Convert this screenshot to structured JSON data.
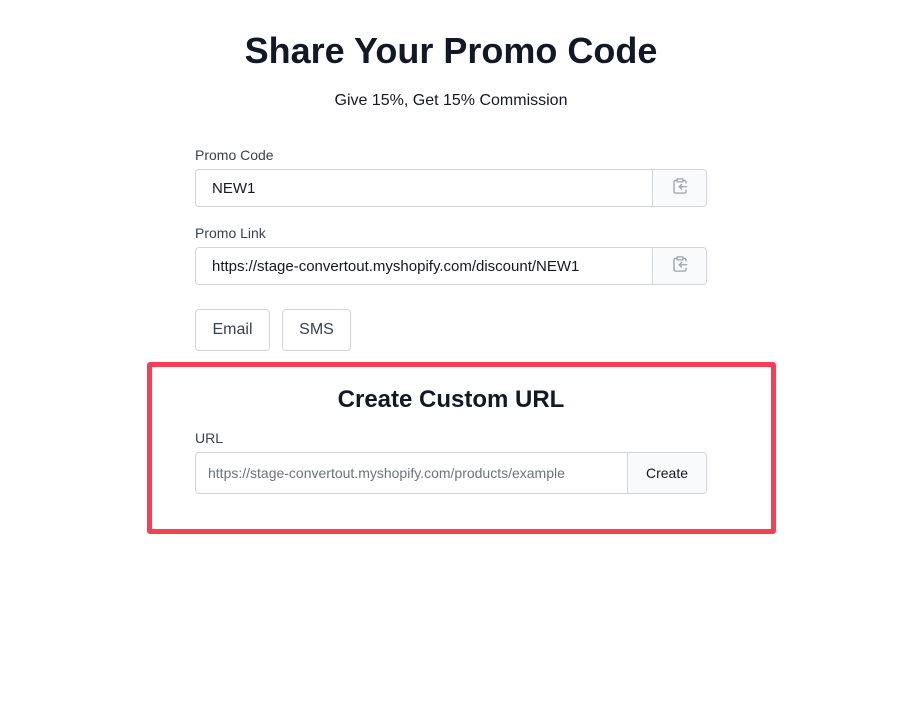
{
  "header": {
    "title": "Share Your Promo Code",
    "subtitle": "Give 15%, Get 15% Commission"
  },
  "promo_code": {
    "label": "Promo Code",
    "value": "NEW1",
    "copy_icon": "clipboard-copy-icon"
  },
  "promo_link": {
    "label": "Promo Link",
    "value": "https://stage-convertout.myshopify.com/discount/NEW1",
    "copy_icon": "clipboard-copy-icon"
  },
  "share": {
    "email_label": "Email",
    "sms_label": "SMS"
  },
  "custom_url": {
    "title": "Create Custom URL",
    "label": "URL",
    "placeholder": "https://stage-convertout.myshopify.com/products/example",
    "value": "",
    "create_label": "Create",
    "highlight_color": "#f43f55"
  }
}
